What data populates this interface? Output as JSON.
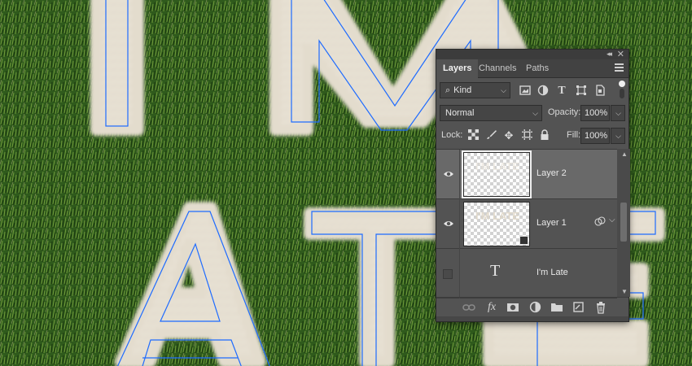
{
  "panel": {
    "tabs": [
      {
        "label": "Layers",
        "active": true
      },
      {
        "label": "Channels",
        "active": false
      },
      {
        "label": "Paths",
        "active": false
      }
    ],
    "filter": {
      "kind_label": "Kind"
    },
    "blend_mode": "Normal",
    "opacity_label": "Opacity:",
    "opacity_value": "100%",
    "lock_label": "Lock:",
    "fill_label": "Fill:",
    "fill_value": "100%",
    "layers": [
      {
        "name": "Layer 2",
        "visible": true,
        "selected": true,
        "thumb_text": "I'M LATE"
      },
      {
        "name": "Layer 1",
        "visible": true,
        "selected": false,
        "thumb_text": "I'M LATE"
      },
      {
        "name": "I'm Late",
        "visible": false,
        "selected": false,
        "type_glyph": "T"
      }
    ],
    "bottom_icons": [
      "link-icon",
      "fx-icon",
      "mask-icon",
      "adjustment-icon",
      "group-folder-icon",
      "new-layer-icon",
      "trash-icon"
    ]
  },
  "colors": {
    "grass": "#2f5a1c",
    "fur": "#e9e3d6",
    "selection_path": "#1e6bff",
    "panel_bg": "#535353",
    "selected_layer": "#696969"
  }
}
